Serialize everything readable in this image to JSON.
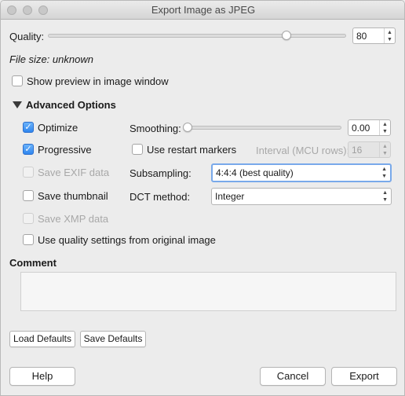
{
  "window": {
    "title": "Export Image as JPEG"
  },
  "quality": {
    "label": "Quality:",
    "value": "80",
    "slider_fraction": 0.8
  },
  "file_size": "File size: unknown",
  "show_preview": {
    "label": "Show preview in image window",
    "checked": false
  },
  "advanced": {
    "header": "Advanced Options",
    "optimize": {
      "label": "Optimize",
      "checked": true
    },
    "progressive": {
      "label": "Progressive",
      "checked": true
    },
    "save_exif": {
      "label": "Save EXIF data",
      "checked": false,
      "enabled": false
    },
    "save_thumbnail": {
      "label": "Save thumbnail",
      "checked": false
    },
    "save_xmp": {
      "label": "Save XMP data",
      "checked": false,
      "enabled": false
    },
    "use_original_quality": {
      "label": "Use quality settings from original image",
      "checked": false
    },
    "smoothing": {
      "label": "Smoothing:",
      "value": "0.00",
      "slider_fraction": 0.0
    },
    "restart_markers": {
      "label": "Use restart markers",
      "checked": false
    },
    "interval": {
      "label": "Interval (MCU rows):",
      "value": "16",
      "enabled": false
    },
    "subsampling": {
      "label": "Subsampling:",
      "value": "4:4:4 (best quality)"
    },
    "dct_method": {
      "label": "DCT method:",
      "value": "Integer"
    }
  },
  "comment": {
    "label": "Comment",
    "value": ""
  },
  "buttons": {
    "load_defaults": "Load Defaults",
    "save_defaults": "Save Defaults",
    "help": "Help",
    "cancel": "Cancel",
    "export": "Export"
  },
  "colors": {
    "accent": "#2f86ef",
    "window_bg": "#ececec"
  }
}
